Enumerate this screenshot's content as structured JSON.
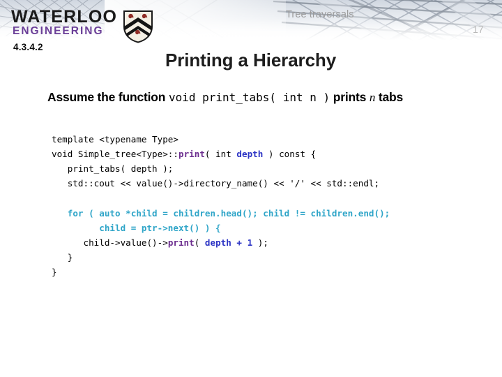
{
  "header": {
    "logo": {
      "line1": "WATERLOO",
      "line2": "ENGINEERING",
      "shield_alt": "university-crest",
      "engineering_color": "#6b3f98"
    },
    "section_number": "4.3.4.2",
    "topic_label": "Tree traversals",
    "slide_number": "17",
    "slide_title": "Printing a Hierarchy"
  },
  "body": {
    "assume": {
      "prefix": "Assume the function ",
      "signature": "void print_tabs( int n )",
      "middle": " prints ",
      "variable": "n",
      "suffix": " tabs"
    },
    "code": {
      "colors": {
        "function": "#6b2d8e",
        "variable": "#2b33c4",
        "loop": "#2fa5c8",
        "plain": "#000000"
      },
      "lines": [
        {
          "id": "l1",
          "text": "template <typename Type>"
        },
        {
          "id": "l2a",
          "text": "void Simple_tree<Type>::"
        },
        {
          "id": "l2b",
          "text": "print"
        },
        {
          "id": "l2c",
          "text": "( int "
        },
        {
          "id": "l2d",
          "text": "depth"
        },
        {
          "id": "l2e",
          "text": " ) const {"
        },
        {
          "id": "l3",
          "text": "   print_tabs( depth );"
        },
        {
          "id": "l4",
          "text": "   std::cout << value()->directory_name() << '/' << std::endl;"
        },
        {
          "id": "l5",
          "text": "   for ( auto *child = children.head(); child != children.end();"
        },
        {
          "id": "l6",
          "text": "         child = ptr->next() ) {"
        },
        {
          "id": "l7a",
          "text": "      child->value()->"
        },
        {
          "id": "l7b",
          "text": "print"
        },
        {
          "id": "l7c",
          "text": "( "
        },
        {
          "id": "l7d",
          "text": "depth + 1"
        },
        {
          "id": "l7e",
          "text": " );"
        },
        {
          "id": "l8",
          "text": "   }"
        },
        {
          "id": "l9",
          "text": "}"
        }
      ]
    }
  }
}
